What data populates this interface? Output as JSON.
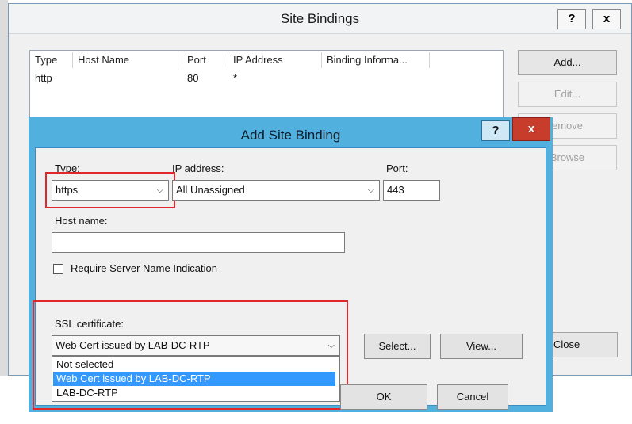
{
  "outer": {
    "title": "Site Bindings",
    "help_glyph": "?",
    "close_glyph": "x",
    "table": {
      "columns": [
        "Type",
        "Host Name",
        "Port",
        "IP Address",
        "Binding Informa..."
      ],
      "rows": [
        {
          "type": "http",
          "host": "",
          "port": "80",
          "ip": "*",
          "info": ""
        }
      ]
    },
    "buttons": {
      "add": "Add...",
      "edit": "Edit...",
      "remove": "emove",
      "browse": "Browse",
      "close": "Close"
    }
  },
  "dialog": {
    "title": "Add Site Binding",
    "help_glyph": "?",
    "close_glyph": "x",
    "type_label": "Type:",
    "type_value": "https",
    "ip_label": "IP address:",
    "ip_value": "All Unassigned",
    "port_label": "Port:",
    "port_value": "443",
    "hostname_label": "Host name:",
    "hostname_value": "",
    "sni_label": "Require Server Name Indication",
    "sni_checked": false,
    "ssl_label": "SSL certificate:",
    "ssl_value": "Web Cert issued by LAB-DC-RTP",
    "ssl_options": [
      "Not selected",
      "Web Cert issued by LAB-DC-RTP",
      "LAB-DC-RTP"
    ],
    "ssl_selected_index": 1,
    "select_button": "Select...",
    "view_button": "View...",
    "ok_button": "OK",
    "cancel_button": "Cancel"
  },
  "icons": {
    "dropdown": "chevron-down-icon",
    "checkbox": "checkbox-icon"
  },
  "colors": {
    "dialog_frame": "#52b0df",
    "close_button": "#c73c2a",
    "highlight_box": "#e0282c",
    "selected_option": "#3399ff"
  }
}
